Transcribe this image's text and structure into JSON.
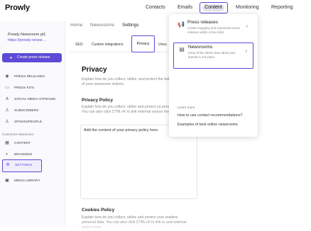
{
  "app": {
    "logo": "Prowly"
  },
  "topnav": {
    "items": [
      "Contacts",
      "Emails",
      "Content",
      "Monitoring",
      "Reporting"
    ],
    "active": "Content"
  },
  "sidebar": {
    "newsroom_name": "Prowly Newsroom pt1",
    "newsroom_url": "https://prowly-newsr...",
    "create_button": "Create press release",
    "items": [
      {
        "label": "PRESS RELEASES",
        "icon": "eye-icon"
      },
      {
        "label": "PRESS KITS",
        "icon": "folder-icon"
      },
      {
        "label": "SOCIAL MEDIA STREAMS",
        "icon": "share-icon"
      },
      {
        "label": "SUBSCRIBERS",
        "icon": "user-icon"
      },
      {
        "label": "SPOKESPEOPLE",
        "icon": "user-icon"
      }
    ],
    "section_label": "Customize Newsroom",
    "customize_items": [
      {
        "label": "CONTENT",
        "icon": "grid-icon"
      },
      {
        "label": "BRANDING",
        "icon": "palette-icon"
      },
      {
        "label": "SETTINGS",
        "icon": "gear-icon"
      }
    ],
    "bottom_items": [
      {
        "label": "MEDIA LIBRARY",
        "icon": "image-icon"
      }
    ]
  },
  "breadcrumb": [
    "Home",
    "Newsrooms",
    "Settings"
  ],
  "tabs": [
    "SEO",
    "Custom integrations",
    "Privacy",
    "Unsu"
  ],
  "active_tab": "Privacy",
  "privacy": {
    "title": "Privacy",
    "description": "Explain how do you collect, utilize, and protect the data of your newsroom visitors.",
    "policy_title": "Privacy Policy",
    "policy_desc": "Explain how do you collect, utilize and protect yo personal data. You can also click CTRL+K to link external source here.",
    "policy_placeholder": "Add the content of your privacy policy here.",
    "cookies_title": "Cookies Policy",
    "cookies_desc": "Explain how do you collect, utilize and protect your readers personal data. You can also click CTRL+K to link to and external source here."
  },
  "dropdown": {
    "items": [
      {
        "title": "Press releases",
        "desc": "Create engaging and responsive press releases within a few clicks",
        "icon": "megaphone-icon"
      },
      {
        "title": "Newsrooms",
        "desc": "Keep all the latest news about your brands in one place",
        "icon": "newsroom-icon"
      }
    ],
    "learn_more": "Learn more",
    "links": [
      "How to use contact recommendations?",
      "Examples of best online newsrooms"
    ]
  },
  "colors": {
    "accent": "#5b4bd6"
  }
}
